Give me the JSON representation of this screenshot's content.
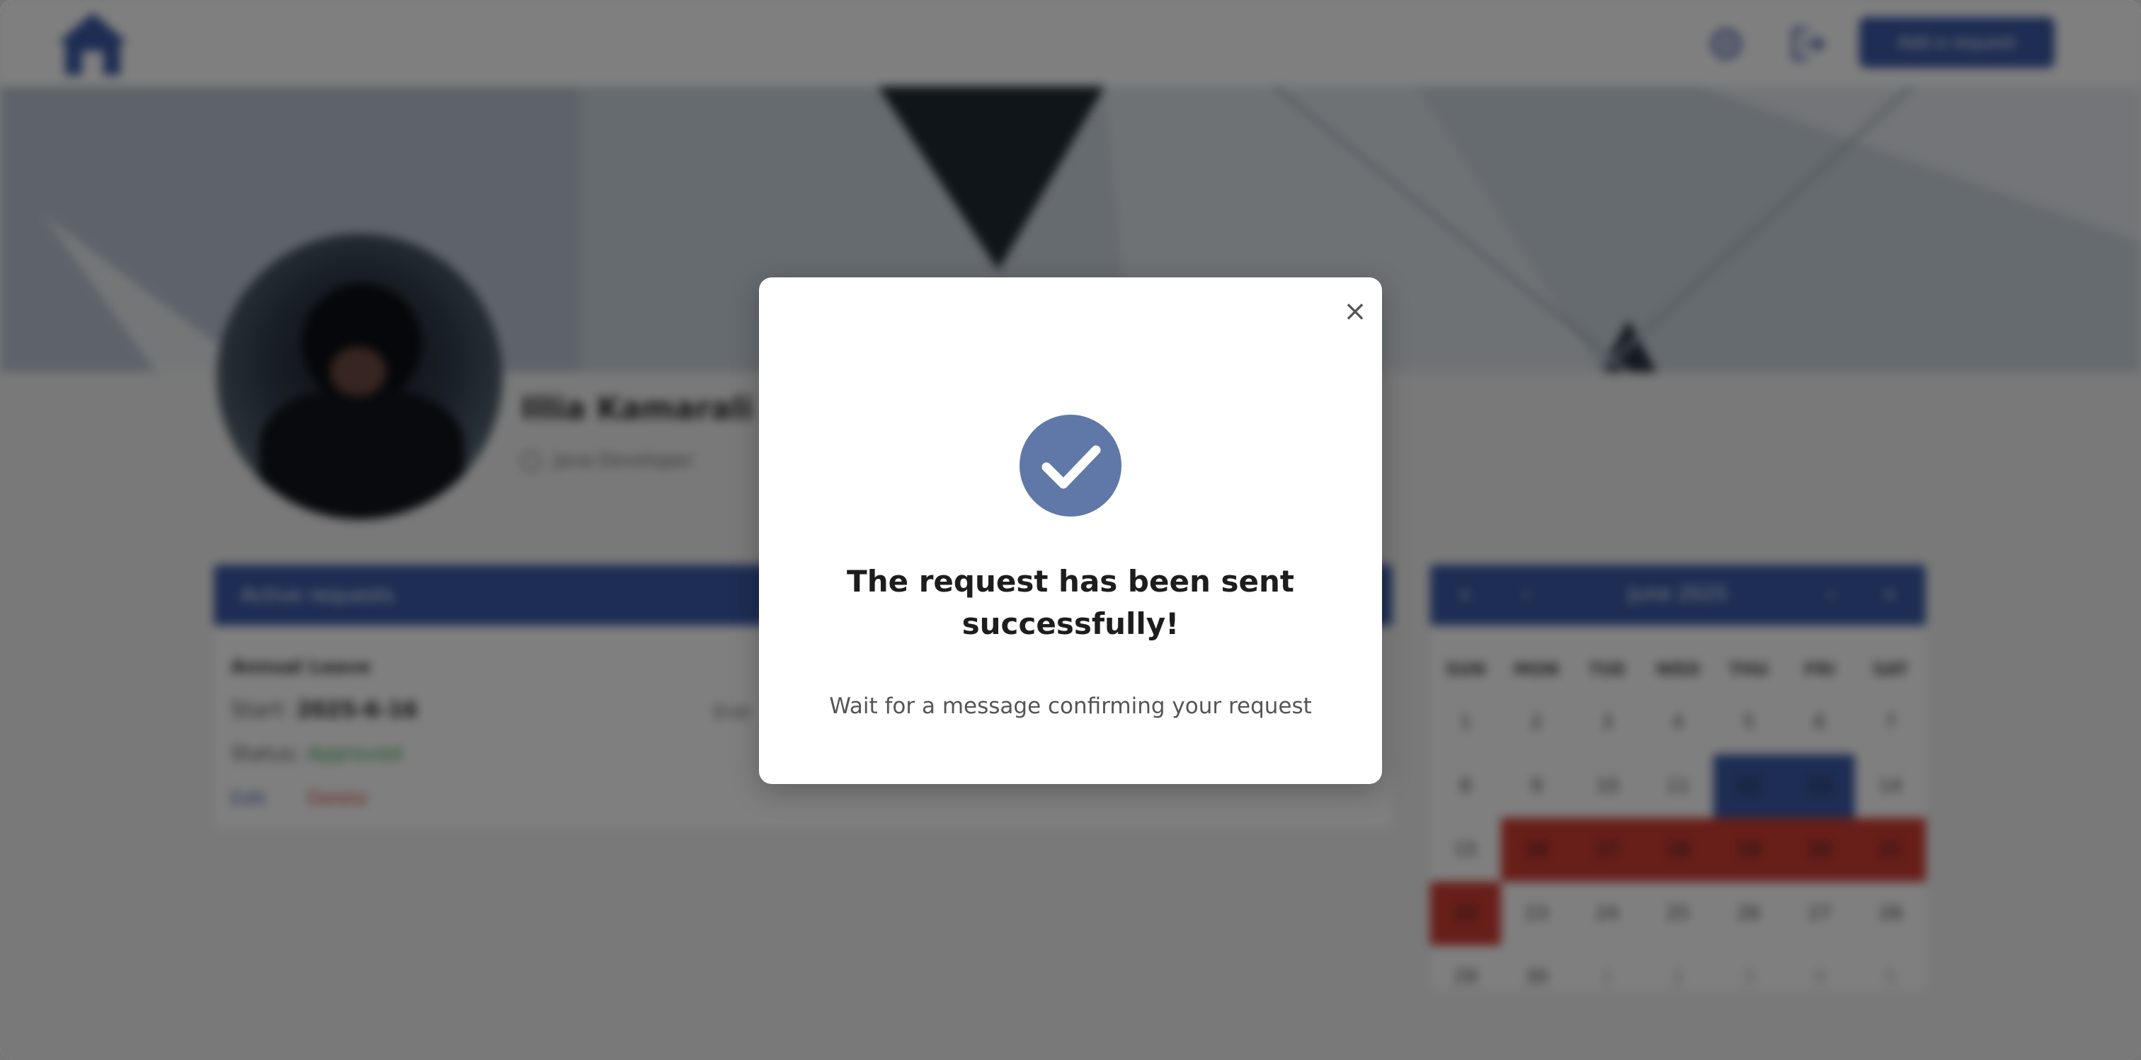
{
  "topbar": {
    "logo_icon": "home-icon",
    "settings_icon": "gear-icon",
    "logout_icon": "logout-icon",
    "add_request_label": "Add a request"
  },
  "profile": {
    "name": "Illia Kamarali",
    "role": "Java Developer",
    "role_icon": "briefcase-icon"
  },
  "requests": {
    "title": "Active requests",
    "items": [
      {
        "type": "Annual Leave",
        "start_label": "Start:",
        "start_value": "2025-6-16",
        "end_label": "End",
        "status_label": "Status:",
        "status_value": "Approved",
        "edit_label": "Edit",
        "delete_label": "Delete"
      }
    ]
  },
  "calendar": {
    "month_title": "June 2025",
    "prev_year": "«",
    "prev_month": "‹",
    "next_month": "›",
    "next_year": "»",
    "weekdays": [
      "SUN",
      "MON",
      "TUE",
      "WED",
      "THU",
      "FRI",
      "SAT"
    ],
    "weeks": [
      [
        "1",
        "2",
        "3",
        "4",
        "5",
        "6",
        "7"
      ],
      [
        "8",
        "9",
        "10",
        "11",
        "12",
        "13",
        "14"
      ],
      [
        "15",
        "16",
        "17",
        "18",
        "19",
        "20",
        "21"
      ],
      [
        "22",
        "23",
        "24",
        "25",
        "26",
        "27",
        "28"
      ],
      [
        "29",
        "30",
        "1",
        "2",
        "3",
        "4",
        "5"
      ]
    ],
    "selected_days": [
      "12",
      "13"
    ],
    "busy_days": [
      "16",
      "17",
      "18",
      "19",
      "20",
      "21",
      "22"
    ],
    "colors": {
      "header": "#3b5aa6",
      "selected": "#3b5aa6",
      "busy": "#d03d33"
    }
  },
  "modal": {
    "close_symbol": "×",
    "check_icon": "check-icon",
    "title": "The request has been sent successfully!",
    "message": "Wait for a message confirming your request",
    "accent_color": "#5f78a8"
  }
}
